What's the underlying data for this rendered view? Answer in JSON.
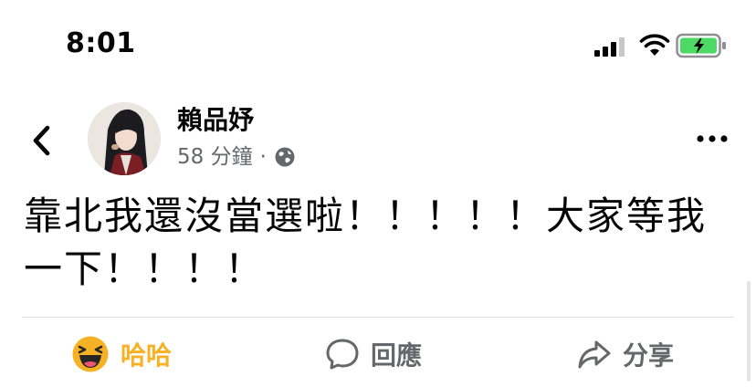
{
  "status_bar": {
    "time": "8:01"
  },
  "post": {
    "author": "賴品妤",
    "timestamp": "58 分鐘",
    "separator": "·",
    "text": "靠北我還沒當選啦！！！！！大家等我一下！！！！"
  },
  "actions": {
    "reaction_label": "哈哈",
    "comment_label": "回應",
    "share_label": "分享"
  },
  "colors": {
    "haha": "#f7b125",
    "secondary_text": "#65676b",
    "battery_green": "#4cd964"
  },
  "icons": [
    "signal-icon",
    "wifi-icon",
    "battery-icon",
    "back-icon",
    "globe-icon",
    "more-icon",
    "haha-emoji-icon",
    "comment-icon",
    "share-icon"
  ]
}
